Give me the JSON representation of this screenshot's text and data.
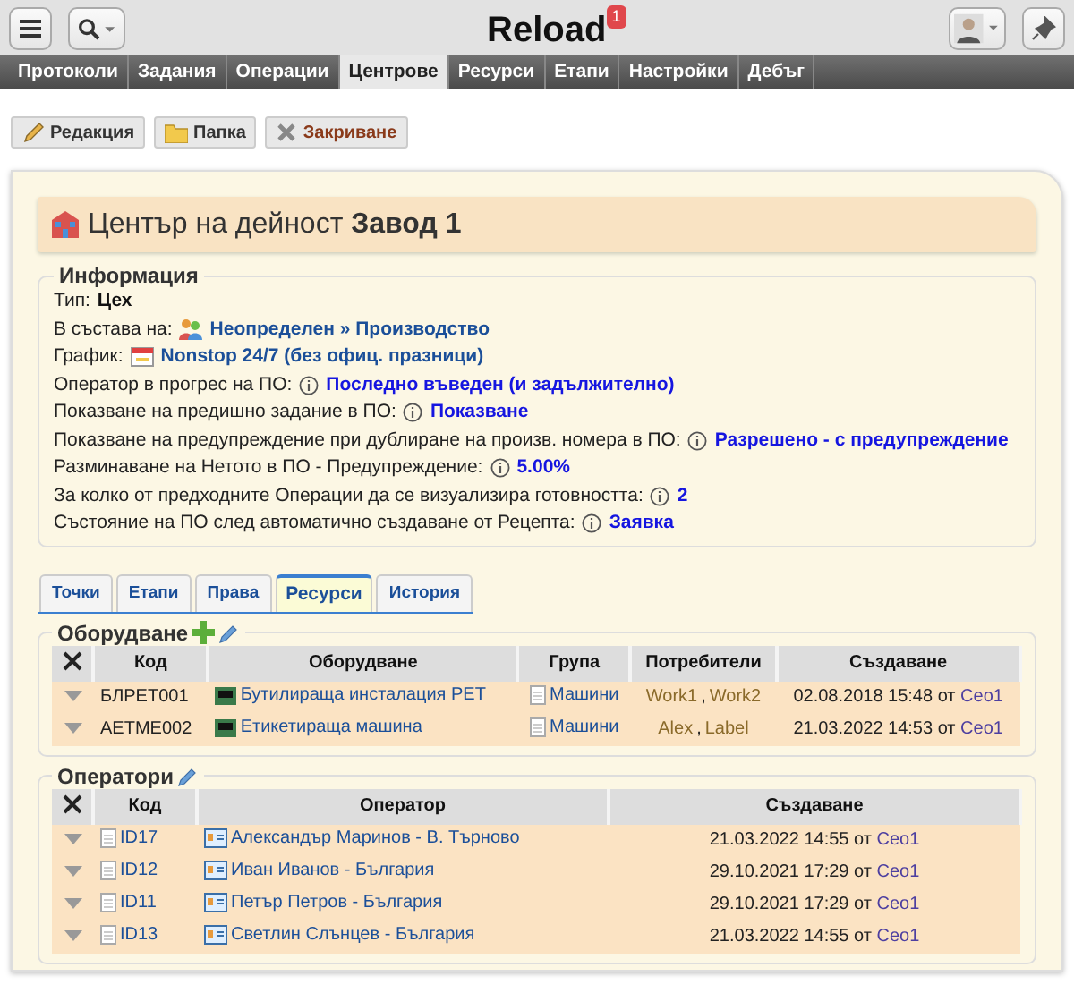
{
  "header": {
    "title": "Reload",
    "badge": "1"
  },
  "nav": [
    {
      "label": "Протоколи",
      "selected": false
    },
    {
      "label": "Задания",
      "selected": false
    },
    {
      "label": "Операции",
      "selected": false
    },
    {
      "label": "Центрове",
      "selected": true
    },
    {
      "label": "Ресурси",
      "selected": false
    },
    {
      "label": "Етапи",
      "selected": false
    },
    {
      "label": "Настройки",
      "selected": false
    },
    {
      "label": "Дебъг",
      "selected": false
    }
  ],
  "toolbar": [
    {
      "label": "Редакция",
      "kind": "edit"
    },
    {
      "label": "Папка",
      "kind": "folder"
    },
    {
      "label": "Закриване",
      "kind": "close"
    }
  ],
  "page_title": {
    "prefix": "Център на дейност",
    "name": "Завод 1"
  },
  "info": {
    "legend": "Информация",
    "rows": [
      {
        "kind": "plain",
        "label": "Тип:",
        "value": "Цех"
      },
      {
        "kind": "membership",
        "label": "В състава на:",
        "value": "Неопределен » Производство"
      },
      {
        "kind": "schedule",
        "label": "График:",
        "value": "Nonstop 24/7 (без офиц. празници)"
      },
      {
        "kind": "setting",
        "label": "Оператор в прогрес на ПО:",
        "value": "Последно въведен (и задължително)"
      },
      {
        "kind": "setting",
        "label": "Показване на предишно задание в ПО:",
        "value": "Показване"
      },
      {
        "kind": "setting",
        "label": "Показване на предупреждение при дублиране на произв. номера в ПО:",
        "value": "Разрешено - с предупреждение"
      },
      {
        "kind": "setting",
        "label": "Разминаване на Нетото в ПО - Предупреждение:",
        "value": "5.00%"
      },
      {
        "kind": "setting",
        "label": "За колко от предходните Операции да се визуализира готовността:",
        "value": "2"
      },
      {
        "kind": "setting",
        "label": "Състояние на ПО след автоматично създаване от Рецепта:",
        "value": "Заявка"
      }
    ]
  },
  "tabs": [
    {
      "label": "Точки",
      "selected": false
    },
    {
      "label": "Етапи",
      "selected": false
    },
    {
      "label": "Права",
      "selected": false
    },
    {
      "label": "Ресурси",
      "selected": true
    },
    {
      "label": "История",
      "selected": false
    }
  ],
  "equipment": {
    "legend": "Оборудване",
    "columns": [
      "Код",
      "Оборудване",
      "Група",
      "Потребители",
      "Създаване"
    ],
    "rows": [
      {
        "code": "БЛРЕТ001",
        "name": "Бутилираща инсталация PET",
        "group": "Машини",
        "users": [
          "Work1",
          "Work2"
        ],
        "separator": ",",
        "created": "02.08.2018 15:48 от",
        "by": "Ceo1"
      },
      {
        "code": "АЕТМЕ002",
        "name": "Етикетираща машина",
        "group": "Машини",
        "users": [
          "Alex",
          "Label"
        ],
        "separator": ",",
        "created": "21.03.2022 14:53 от",
        "by": "Ceo1"
      }
    ]
  },
  "operators": {
    "legend": "Оператори",
    "columns": [
      "Код",
      "Оператор",
      "Създаване"
    ],
    "rows": [
      {
        "code": "ID17",
        "name": "Александър Маринов - В. Търново",
        "created": "21.03.2022 14:55 от",
        "by": "Ceo1"
      },
      {
        "code": "ID12",
        "name": "Иван Иванов - България",
        "created": "29.10.2021 17:29 от",
        "by": "Ceo1"
      },
      {
        "code": "ID11",
        "name": "Петър Петров - България",
        "created": "29.10.2021 17:29 от",
        "by": "Ceo1"
      },
      {
        "code": "ID13",
        "name": "Светлин Слънцев - България",
        "created": "21.03.2022 14:55 от",
        "by": "Ceo1"
      }
    ]
  }
}
